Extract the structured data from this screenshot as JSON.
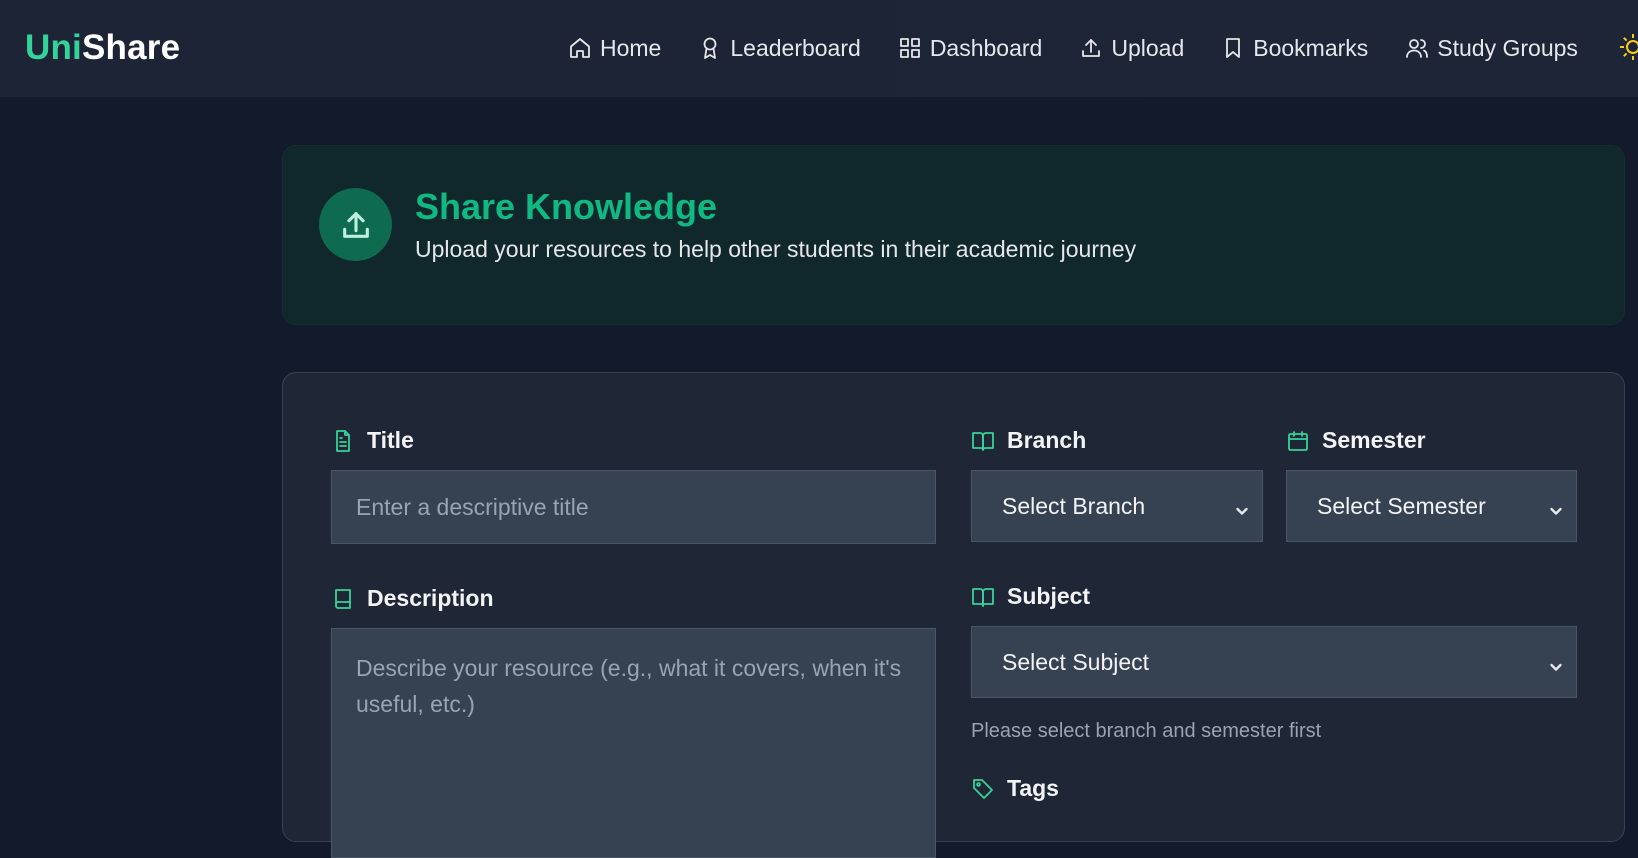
{
  "brand": {
    "part1": "Uni",
    "part2": "Share"
  },
  "nav": {
    "items": [
      {
        "label": "Home",
        "icon": "home-icon"
      },
      {
        "label": "Leaderboard",
        "icon": "award-icon"
      },
      {
        "label": "Dashboard",
        "icon": "grid-icon"
      },
      {
        "label": "Upload",
        "icon": "upload-icon"
      },
      {
        "label": "Bookmarks",
        "icon": "bookmark-icon"
      },
      {
        "label": "Study Groups",
        "icon": "users-icon"
      }
    ],
    "theme_icon": "sun-icon"
  },
  "hero": {
    "title": "Share Knowledge",
    "subtitle": "Upload your resources to help other students in their academic journey",
    "icon": "upload-icon"
  },
  "form": {
    "title": {
      "label": "Title",
      "placeholder": "Enter a descriptive title",
      "value": ""
    },
    "description": {
      "label": "Description",
      "placeholder": "Describe your resource (e.g., what it covers, when it's useful, etc.)",
      "value": ""
    },
    "branch": {
      "label": "Branch",
      "selected": "Select Branch"
    },
    "semester": {
      "label": "Semester",
      "selected": "Select Semester"
    },
    "subject": {
      "label": "Subject",
      "selected": "Select Subject",
      "hint": "Please select branch and semester first"
    },
    "tags": {
      "label": "Tags"
    }
  },
  "colors": {
    "accent": "#10b981",
    "accent_light": "#34d399",
    "background": "#131a2b",
    "topbar": "#1c2436",
    "card": "#1f2636",
    "hero_bg": "#10272c",
    "input_bg": "#364152",
    "sun": "#facc15"
  }
}
